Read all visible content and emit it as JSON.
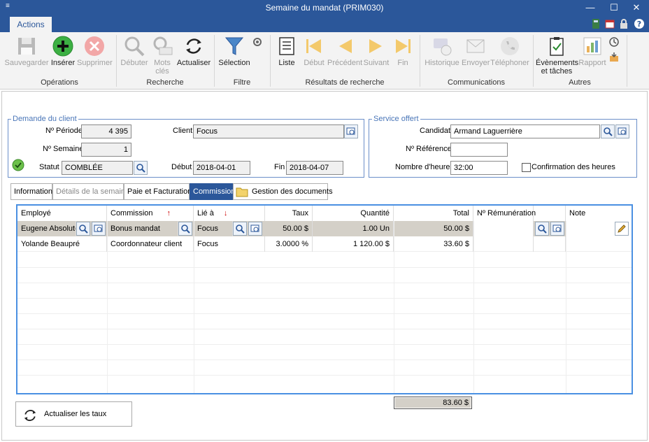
{
  "window": {
    "title": "Semaine du mandat (PRIM030)"
  },
  "ribbon": {
    "tab_label": "Actions",
    "buttons": {
      "sauvegarder": "Sauvegarder",
      "inserer": "Insérer",
      "supprimer": "Supprimer",
      "debuter": "Débuter",
      "mots_cles_1": "Mots",
      "mots_cles_2": "clés",
      "actualiser": "Actualiser",
      "selection": "Sélection",
      "liste": "Liste",
      "debut": "Début",
      "precedent": "Précédent",
      "suivant": "Suivant",
      "fin": "Fin",
      "historique": "Historique",
      "envoyer": "Envoyer",
      "telephoner": "Téléphoner",
      "evenements_1": "Évènements",
      "evenements_2": "et tâches",
      "rapport": "Rapport"
    },
    "groups": {
      "operations": "Opérations",
      "recherche": "Recherche",
      "filtre": "Filtre",
      "resultats": "Résultats de recherche",
      "communications": "Communications",
      "autres": "Autres"
    },
    "accent_color": "#2b579a"
  },
  "demande": {
    "legend": "Demande du client",
    "periode_label": "Nº Période",
    "periode_value": "4 395",
    "semaine_label": "Nº Semaine",
    "semaine_value": "1",
    "statut_label": "Statut",
    "statut_value": "COMBLÉE",
    "client_label": "Client",
    "client_value": "Focus",
    "debut_label": "Début",
    "debut_value": "2018-04-01",
    "fin_label": "Fin",
    "fin_value": "2018-04-07"
  },
  "service": {
    "legend": "Service offert",
    "candidat_label": "Candidat",
    "candidat_value": "Armand Laguerrière",
    "reference_label": "Nº Référence",
    "reference_value": "",
    "heures_label": "Nombre d'heures",
    "heures_value": "32:00",
    "confirmation_label": "Confirmation des heures"
  },
  "tabs": [
    "Information",
    "Détails de la semaine",
    "Paie et Facturation",
    "Commission",
    "Gestion des documents"
  ],
  "grid": {
    "columns": [
      "Employé",
      "Commission",
      "Lié à",
      "Taux",
      "Quantité",
      "Total",
      "Nº Rémunération",
      "",
      "Note"
    ],
    "rows": [
      [
        "Eugene Absolute",
        "Bonus mandat",
        "Focus",
        "50.00 $",
        "1.00 Un",
        "50.00 $",
        "",
        "",
        ""
      ],
      [
        "Yolande Beaupré",
        "Coordonnateur client",
        "Focus",
        "3.0000 %",
        "1 120.00 $",
        "33.60 $",
        "",
        "",
        ""
      ]
    ]
  },
  "footer": {
    "total": "83.60 $",
    "refresh_label": "Actualiser les taux"
  }
}
